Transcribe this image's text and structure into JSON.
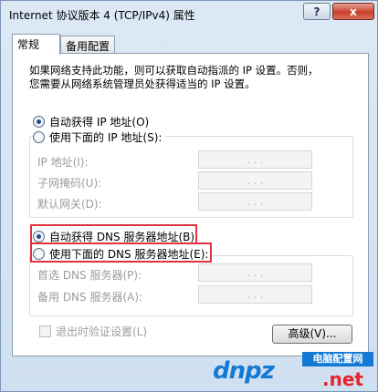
{
  "window": {
    "title": "Internet 协议版本 4 (TCP/IPv4) 属性",
    "help_label": "?",
    "close_label": "x"
  },
  "tabs": [
    {
      "label": "常规",
      "active": true
    },
    {
      "label": "备用配置",
      "active": false
    }
  ],
  "description": {
    "line1": "如果网络支持此功能，则可以获取自动指派的 IP 设置。否则，",
    "line2": "您需要从网络系统管理员处获得适当的 IP 设置。"
  },
  "ip_section": {
    "auto_label": "自动获得 IP 地址(O)",
    "auto_selected": true,
    "manual_label": "使用下面的 IP 地址(S):",
    "fields": [
      {
        "label": "IP 地址(I):",
        "dots": ".   .   ."
      },
      {
        "label": "子网掩码(U):",
        "dots": ".   .   ."
      },
      {
        "label": "默认网关(D):",
        "dots": ".   .   ."
      }
    ]
  },
  "dns_section": {
    "auto_label": "自动获得 DNS 服务器地址(B)",
    "auto_selected": true,
    "manual_label": "使用下面的 DNS 服务器地址(E):",
    "fields": [
      {
        "label": "首选 DNS 服务器(P):",
        "dots": ".   .   ."
      },
      {
        "label": "备用 DNS 服务器(A):",
        "dots": ".   .   ."
      }
    ]
  },
  "footer": {
    "validate_label": "退出时验证设置(L)",
    "validate_checked": false,
    "advanced_label": "高级(V)..."
  },
  "watermark": {
    "logo": "dnpz",
    "tag": "电脑配置网",
    "domain": ".net"
  },
  "colors": {
    "highlight": "#e0323c",
    "accent": "#1479d2"
  }
}
